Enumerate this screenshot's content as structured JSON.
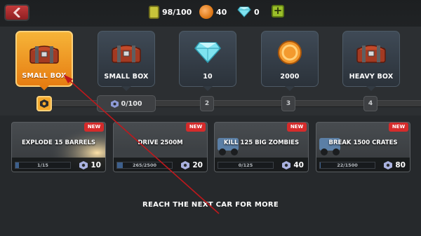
{
  "resources": {
    "fuel": "98/100",
    "coins": "40",
    "gems": "0"
  },
  "rewards": [
    {
      "label": "SMALL BOX",
      "icon": "chest-icon",
      "active": true
    },
    {
      "label": "SMALL BOX",
      "icon": "chest-icon",
      "active": false
    },
    {
      "label": "10",
      "icon": "gem-icon",
      "active": false
    },
    {
      "label": "2000",
      "icon": "coin-icon",
      "active": false
    },
    {
      "label": "HEAVY BOX",
      "icon": "chest-icon",
      "active": false
    }
  ],
  "track": {
    "progress_text": "0/100",
    "nodes": [
      "2",
      "3",
      "4"
    ]
  },
  "missions": [
    {
      "title": "EXPLODE 15 BARRELS",
      "progress": "1/15",
      "progress_fraction": 0.067,
      "reward": "10",
      "badge": "NEW"
    },
    {
      "title": "DRIVE 2500M",
      "progress": "265/2500",
      "progress_fraction": 0.106,
      "reward": "20",
      "badge": "NEW"
    },
    {
      "title": "KILL 125 BIG ZOMBIES",
      "progress": "0/125",
      "progress_fraction": 0.0,
      "reward": "40",
      "badge": "NEW"
    },
    {
      "title": "BREAK 1500 CRATES",
      "progress": "22/1500",
      "progress_fraction": 0.015,
      "reward": "80",
      "badge": "NEW"
    }
  ],
  "footer": "REACH THE NEXT CAR FOR MORE",
  "colors": {
    "accent_orange": "#f4a92d",
    "badge_red": "#d52b2b",
    "back_red": "#b3302f",
    "arrow_red": "#c0181c"
  }
}
